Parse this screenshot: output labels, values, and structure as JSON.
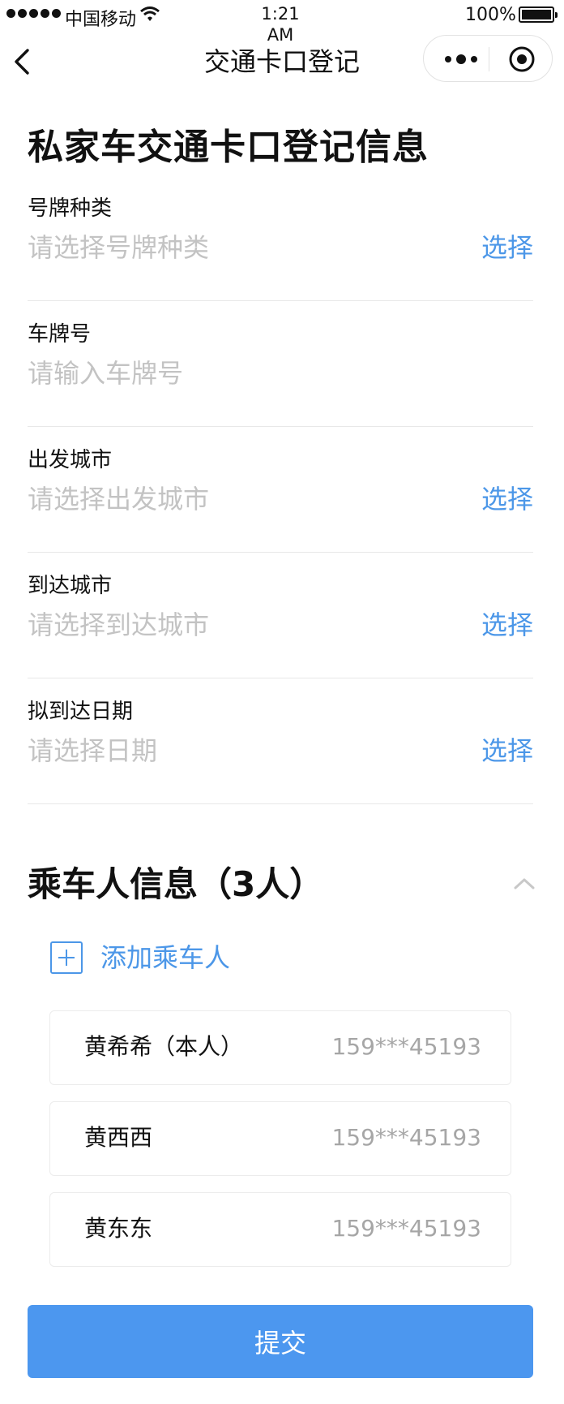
{
  "status_bar": {
    "carrier": "中国移动",
    "time": "1:21\nAM",
    "battery_percent": "100%"
  },
  "nav": {
    "title": "交通卡口登记",
    "icons": [
      "back-icon",
      "more-icon",
      "target-icon"
    ]
  },
  "form": {
    "title": "私家车交通卡口登记信息",
    "fields": [
      {
        "label": "号牌种类",
        "placeholder": "请选择号牌种类",
        "action": "选择"
      },
      {
        "label": "车牌号",
        "placeholder": "请输入车牌号",
        "action": ""
      },
      {
        "label": "出发城市",
        "placeholder": "请选择出发城市",
        "action": "选择"
      },
      {
        "label": "到达城市",
        "placeholder": "请选择到达城市",
        "action": "选择"
      },
      {
        "label": "拟到达日期",
        "placeholder": "请选择日期",
        "action": "选择"
      }
    ]
  },
  "passengers": {
    "title": "乘车人信息（3人）",
    "add_label": "添加乘车人",
    "list": [
      {
        "name": "黄希希（本人）",
        "phone": "159***45193"
      },
      {
        "name": "黄西西",
        "phone": "159***45193"
      },
      {
        "name": "黄东东",
        "phone": "159***45193"
      }
    ]
  },
  "submit_label": "提交",
  "colors": {
    "accent": "#4c97e8",
    "button": "#4c97ef",
    "placeholder": "#c3c3c3",
    "phone_text": "#a6a6a6"
  }
}
